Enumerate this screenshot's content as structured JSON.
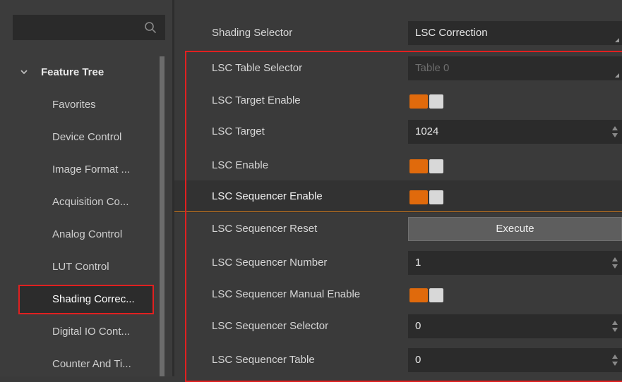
{
  "search": {
    "placeholder": ""
  },
  "tree": {
    "title": "Feature Tree",
    "items": [
      {
        "label": "Favorites"
      },
      {
        "label": "Device Control"
      },
      {
        "label": "Image Format ..."
      },
      {
        "label": "Acquisition Co..."
      },
      {
        "label": "Analog Control"
      },
      {
        "label": "LUT Control"
      },
      {
        "label": "Shading Correc..."
      },
      {
        "label": "Digital IO Cont..."
      },
      {
        "label": "Counter And Ti..."
      }
    ],
    "selected_index": 6
  },
  "properties": {
    "shading_selector": {
      "label": "Shading Selector",
      "value": "LSC Correction"
    },
    "lsc_table_selector": {
      "label": "LSC Table Selector",
      "value": "Table 0"
    },
    "lsc_target_enable": {
      "label": "LSC Target Enable",
      "value": "on"
    },
    "lsc_target": {
      "label": "LSC Target",
      "value": "1024"
    },
    "lsc_enable": {
      "label": "LSC Enable",
      "value": "on"
    },
    "lsc_sequencer_enable": {
      "label": "LSC Sequencer Enable",
      "value": "on"
    },
    "lsc_sequencer_reset": {
      "label": "LSC Sequencer Reset",
      "button": "Execute"
    },
    "lsc_sequencer_number": {
      "label": "LSC Sequencer Number",
      "value": "1"
    },
    "lsc_sequencer_manual_enable": {
      "label": "LSC Sequencer Manual Enable",
      "value": "on"
    },
    "lsc_sequencer_selector": {
      "label": "LSC Sequencer Selector",
      "value": "0"
    },
    "lsc_sequencer_table": {
      "label": "LSC Sequencer Table",
      "value": "0"
    }
  },
  "colors": {
    "accent": "#e06a0c",
    "highlight_border": "#e02020"
  }
}
